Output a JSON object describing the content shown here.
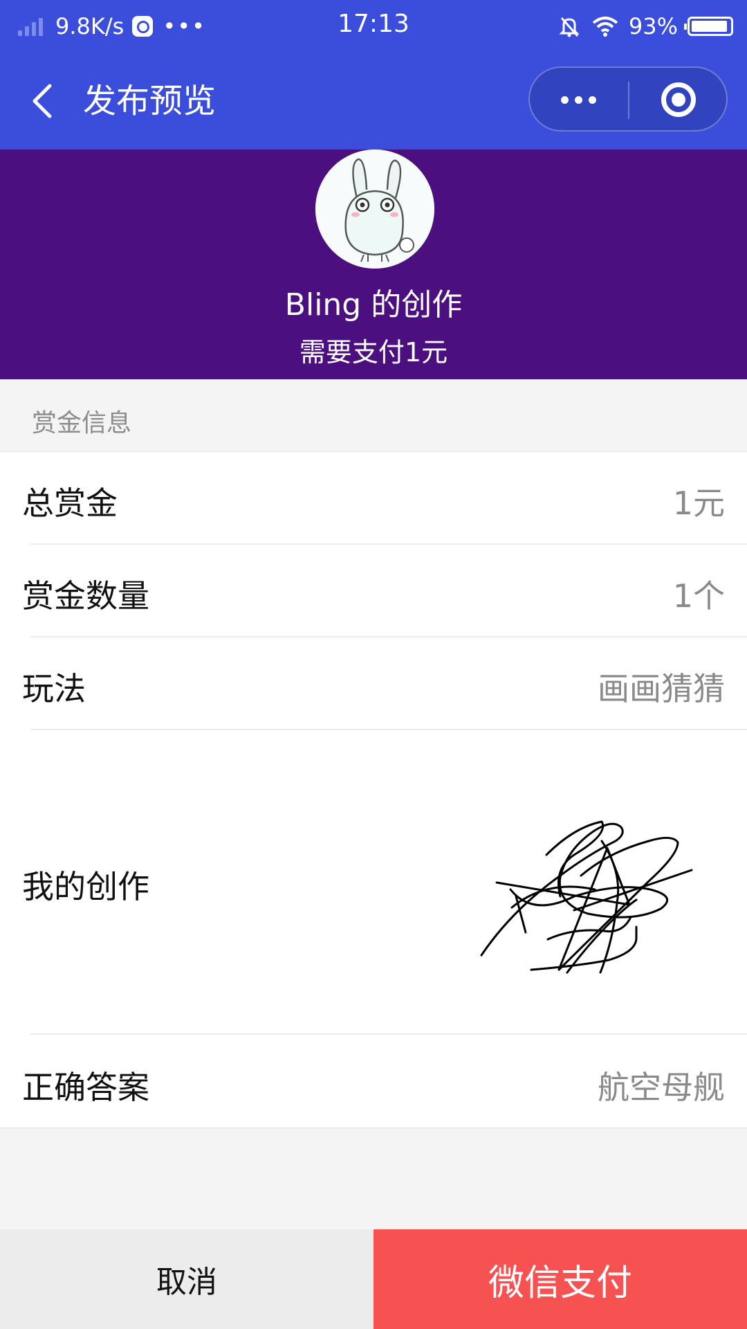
{
  "status_bar": {
    "net_speed": "9.8K/s",
    "more": "•••",
    "time": "17:13",
    "battery": "93%",
    "icons": [
      "signal-icon",
      "app-notification-icon",
      "mute-bell-icon",
      "wifi-icon",
      "battery-icon"
    ]
  },
  "nav": {
    "title": "发布预览",
    "icons": [
      "back-arrow-icon",
      "more-dots-icon",
      "close-target-icon"
    ]
  },
  "header": {
    "author": "Bling 的创作",
    "pay_note": "需要支付1元",
    "background": "#4b0f7f"
  },
  "section": {
    "title": "赏金信息"
  },
  "rows": [
    {
      "label": "总赏金",
      "value": "1元"
    },
    {
      "label": "赏金数量",
      "value": "1个"
    },
    {
      "label": "玩法",
      "value": "画画猜猜"
    },
    {
      "label": "我的创作",
      "value": ""
    },
    {
      "label": "正确答案",
      "value": "航空母舰"
    }
  ],
  "buttons": {
    "cancel": "取消",
    "pay": "微信支付",
    "pay_color": "#f65252"
  },
  "theme": {
    "nav_color": "#3a4ddb"
  }
}
